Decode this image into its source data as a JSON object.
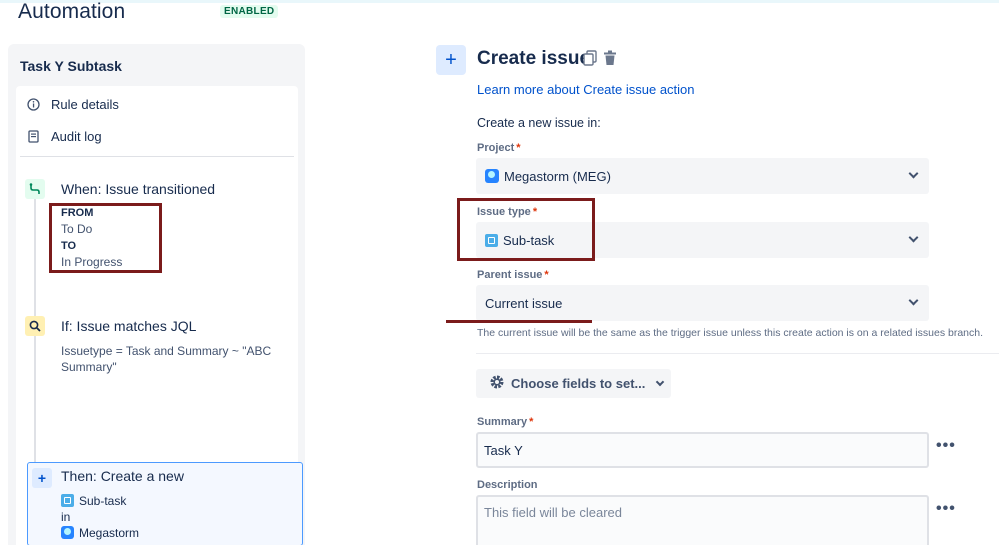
{
  "header": {
    "title": "Automation",
    "status_badge": "ENABLED"
  },
  "sidebar": {
    "rule_name": "Task Y Subtask",
    "nav": [
      {
        "label": "Rule details",
        "icon": "info-icon"
      },
      {
        "label": "Audit log",
        "icon": "document-icon"
      }
    ],
    "trigger": {
      "title": "When: Issue transitioned",
      "from_label": "FROM",
      "from_value": "To Do",
      "to_label": "TO",
      "to_value": "In Progress",
      "icon": "transition-icon"
    },
    "condition": {
      "title": "If: Issue matches JQL",
      "jql": "Issuetype = Task and Summary ~ \"ABC Summary\"",
      "icon": "search-icon"
    },
    "action": {
      "title": "Then: Create a new",
      "issue_type": "Sub-task",
      "in_label": "in",
      "project": "Megastorm",
      "icon": "plus-icon"
    }
  },
  "panel": {
    "title": "Create issue",
    "learn_more": "Learn more about Create issue action",
    "create_in": "Create a new issue in:",
    "project": {
      "label": "Project",
      "required": "*",
      "value": "Megastorm (MEG)"
    },
    "issue_type": {
      "label": "Issue type",
      "required": "*",
      "value": "Sub-task"
    },
    "parent_issue": {
      "label": "Parent issue",
      "required": "*",
      "value": "Current issue"
    },
    "parent_help": "The current issue will be the same as the trigger issue unless this create action is on a related issues branch.",
    "choose_fields": "Choose fields to set...",
    "summary": {
      "label": "Summary",
      "required": "*",
      "value": "Task Y"
    },
    "description": {
      "label": "Description",
      "placeholder": "This field will be cleared"
    },
    "more_dots": "•••"
  },
  "colors": {
    "accent": "#0052cc",
    "highlight_box": "#7b1b1b",
    "badge_bg": "#e3fcef",
    "badge_text": "#006644"
  }
}
